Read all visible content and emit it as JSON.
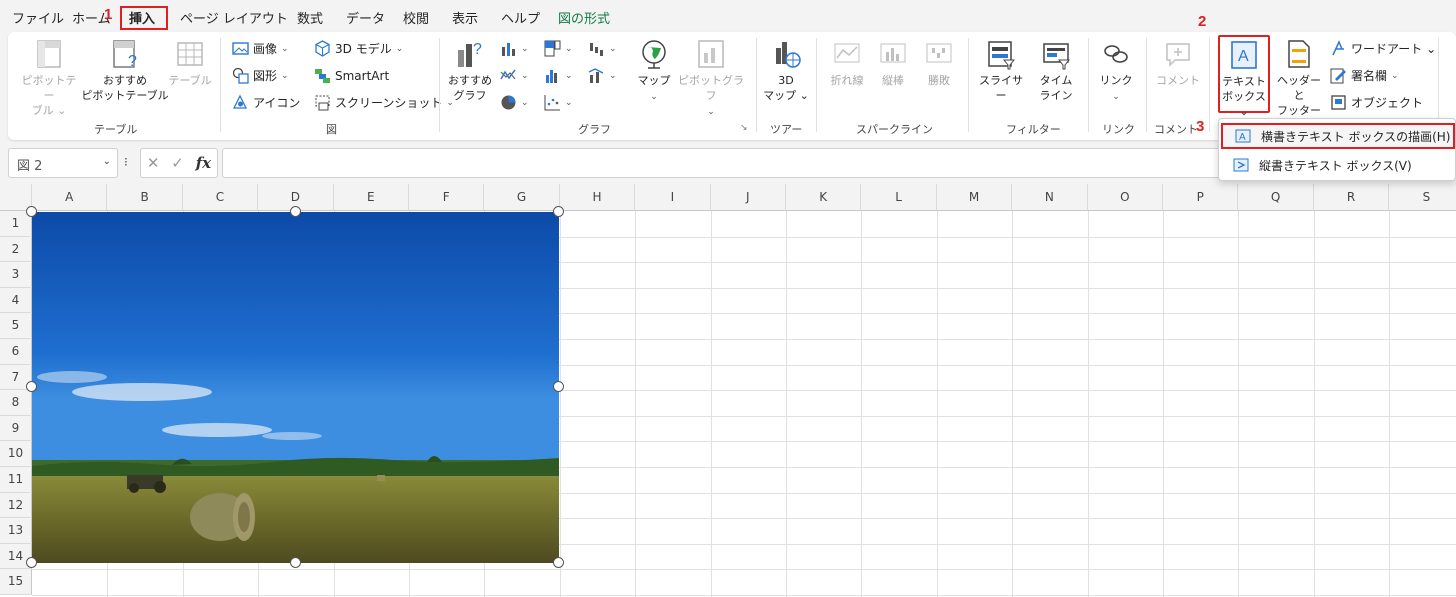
{
  "menu": {
    "tabs": [
      {
        "label": "ファイル"
      },
      {
        "label": "ホーム"
      },
      {
        "label": "挿入"
      },
      {
        "label": "ページ レイアウト"
      },
      {
        "label": "数式"
      },
      {
        "label": "データ"
      },
      {
        "label": "校閲"
      },
      {
        "label": "表示"
      },
      {
        "label": "ヘルプ"
      },
      {
        "label": "図の形式"
      }
    ]
  },
  "steps": {
    "s1": "1",
    "s2": "2",
    "s3": "3"
  },
  "ribbon": {
    "table": {
      "pivot": "ピボットテー\nブル ⌄",
      "recommended_pivot": "おすすめ\nピボットテーブル",
      "table": "テーブル",
      "group": "テーブル"
    },
    "illustrations": {
      "image": "画像",
      "shape": "図形",
      "icon": "アイコン",
      "model3d": "3D モデル",
      "smartart": "SmartArt",
      "screenshot": "スクリーンショット",
      "group": "図"
    },
    "charts": {
      "recommended": "おすすめ\nグラフ",
      "map": "マップ",
      "pivotchart": "ピボットグラフ",
      "group": "グラフ"
    },
    "tours": {
      "map3d": "3D\nマップ ⌄",
      "group": "ツアー"
    },
    "sparklines": {
      "line": "折れ線",
      "column": "縦棒",
      "winloss": "勝敗",
      "group": "スパークライン"
    },
    "filters": {
      "slicer": "スライサー",
      "timeline": "タイム\nライン",
      "group": "フィルター"
    },
    "links": {
      "link": "リンク",
      "group": "リンク"
    },
    "comments": {
      "comment": "コメント",
      "group": "コメント"
    },
    "text": {
      "textbox": "テキスト\nボックス ⌄",
      "header_footer": "ヘッダーと\nフッター",
      "wordart": "ワードアート ⌄",
      "signature": "署名欄",
      "object": "オブジェクト"
    }
  },
  "formula_bar": {
    "name_box": "図 2",
    "cancel": "✕",
    "enter": "✓",
    "fx": "fx",
    "formula": ""
  },
  "columns": [
    "A",
    "B",
    "C",
    "D",
    "E",
    "F",
    "G",
    "H",
    "I",
    "J",
    "K",
    "L",
    "M",
    "N",
    "O",
    "P",
    "Q",
    "R",
    "S"
  ],
  "rows": [
    "1",
    "2",
    "3",
    "4",
    "5",
    "6",
    "7",
    "8",
    "9",
    "10",
    "11",
    "12",
    "13",
    "14",
    "15"
  ],
  "dropdown": {
    "horizontal": "横書きテキスト ボックスの描画(H)",
    "vertical": "縦書きテキスト ボックス(V)"
  },
  "colors": {
    "accent_green": "#107c41",
    "highlight_red": "#e02020"
  }
}
